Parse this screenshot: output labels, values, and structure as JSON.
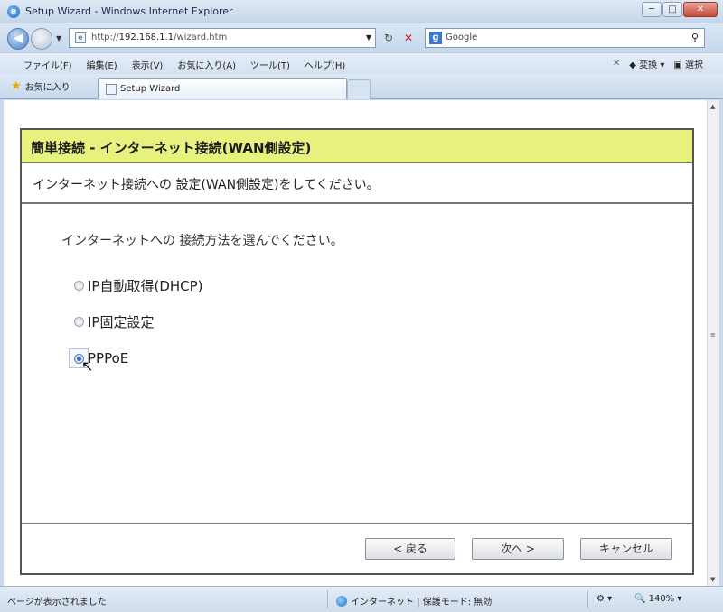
{
  "window": {
    "title": "Setup Wizard - Windows Internet Explorer",
    "min": "─",
    "max": "□",
    "close": "✕"
  },
  "address": {
    "url_prefix": "http://",
    "url_host": "192.168.1.1",
    "url_path": "/wizard.htm"
  },
  "search": {
    "engine": "Google",
    "logo": "g"
  },
  "menu": {
    "items": [
      "ファイル(F)",
      "編集(E)",
      "表示(V)",
      "お気に入り(A)",
      "ツール(T)",
      "ヘルプ(H)"
    ],
    "translate": "変換",
    "select": "選択"
  },
  "favorites": {
    "label": "お気に入り"
  },
  "tab": {
    "title": "Setup Wizard"
  },
  "wizard": {
    "header": "簡単接続 - インターネット接続(WAN側設定)",
    "subheader": "インターネット接続への 設定(WAN側設定)をしてください。",
    "question": "インターネットへの 接続方法を選んでください。",
    "options": [
      "IP自動取得(DHCP)",
      "IP固定設定",
      "PPPoE"
    ],
    "selected_option": "PPPoE",
    "buttons": {
      "back": "< 戻る",
      "next": "次へ >",
      "cancel": "キャンセル"
    }
  },
  "status": {
    "message": "ページが表示されました",
    "zone": "インターネット | 保護モード: 無効",
    "zoom": "140%"
  }
}
